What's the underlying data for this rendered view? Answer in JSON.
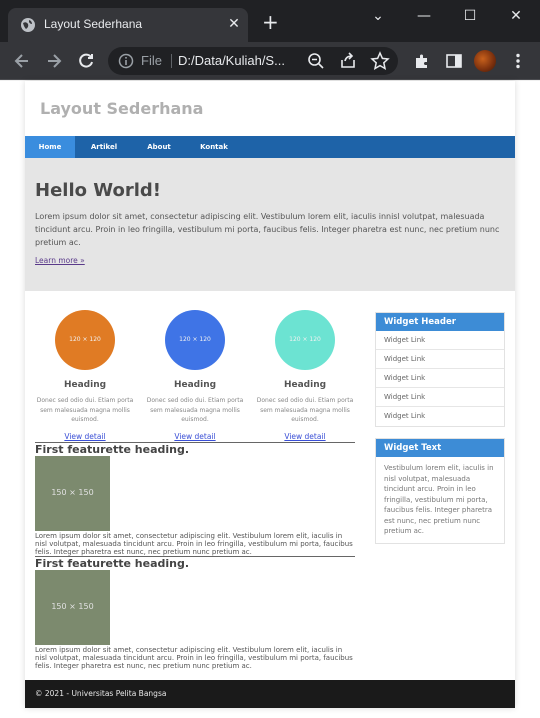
{
  "browser": {
    "tab_title": "Layout Sederhana",
    "url_scheme_label": "File",
    "url": "D:/Data/Kuliah/S..."
  },
  "site": {
    "title": "Layout Sederhana",
    "nav": [
      "Home",
      "Artikel",
      "About",
      "Kontak"
    ],
    "hero": {
      "title": "Hello World!",
      "text": "Lorem ipsum dolor sit amet, consectetur adipiscing elit. Vestibulum lorem elit, iaculis innisl volutpat, malesuada tincidunt arcu. Proin in leo fringilla, vestibulum mi porta, faucibus felis. Integer pharetra est nunc, nec pretium nunc pretium ac.",
      "link": "Learn more »"
    },
    "columns": [
      {
        "image_label": "120 × 120",
        "heading": "Heading",
        "text": "Donec sed odio dui. Etiam porta sem malesuada magna mollis euismod.",
        "link": "View detail",
        "color": "#e07b24"
      },
      {
        "image_label": "120 × 120",
        "heading": "Heading",
        "text": "Donec sed odio dui. Etiam porta sem malesuada magna mollis euismod.",
        "link": "View detail",
        "color": "#3f74e6"
      },
      {
        "image_label": "120 × 120",
        "heading": "Heading",
        "text": "Donec sed odio dui. Etiam porta sem malesuada magna mollis euismod.",
        "link": "View detail",
        "color": "#6ce3d2"
      }
    ],
    "featurettes": [
      {
        "heading": "First featurette heading.",
        "image_label": "150 × 150",
        "text": "Lorem ipsum dolor sit amet, consectetur adipiscing elit. Vestibulum lorem elit, iaculis in nisl volutpat, malesuada tincidunt arcu. Proin in leo fringilla, vestibulum mi porta, faucibus felis. Integer pharetra est nunc, nec pretium nunc pretium ac."
      },
      {
        "heading": "First featurette heading.",
        "image_label": "150 × 150",
        "text": "Lorem ipsum dolor sit amet, consectetur adipiscing elit. Vestibulum lorem elit, iaculis in nisl volutpat, malesuada tincidunt arcu. Proin in leo fringilla, vestibulum mi porta, faucibus felis. Integer pharetra est nunc, nec pretium nunc pretium ac."
      }
    ],
    "widget_links": {
      "title": "Widget Header",
      "items": [
        "Widget Link",
        "Widget Link",
        "Widget Link",
        "Widget Link",
        "Widget Link"
      ]
    },
    "widget_text": {
      "title": "Widget Text",
      "text": "Vestibulum lorem elit, iaculis in nisl volutpat, malesuada tincidunt arcu. Proin in leo fringilla, vestibulum mi porta, faucibus felis. Integer pharetra est nunc, nec pretium nunc pretium ac."
    },
    "footer": "© 2021 - Universitas Pelita Bangsa"
  }
}
